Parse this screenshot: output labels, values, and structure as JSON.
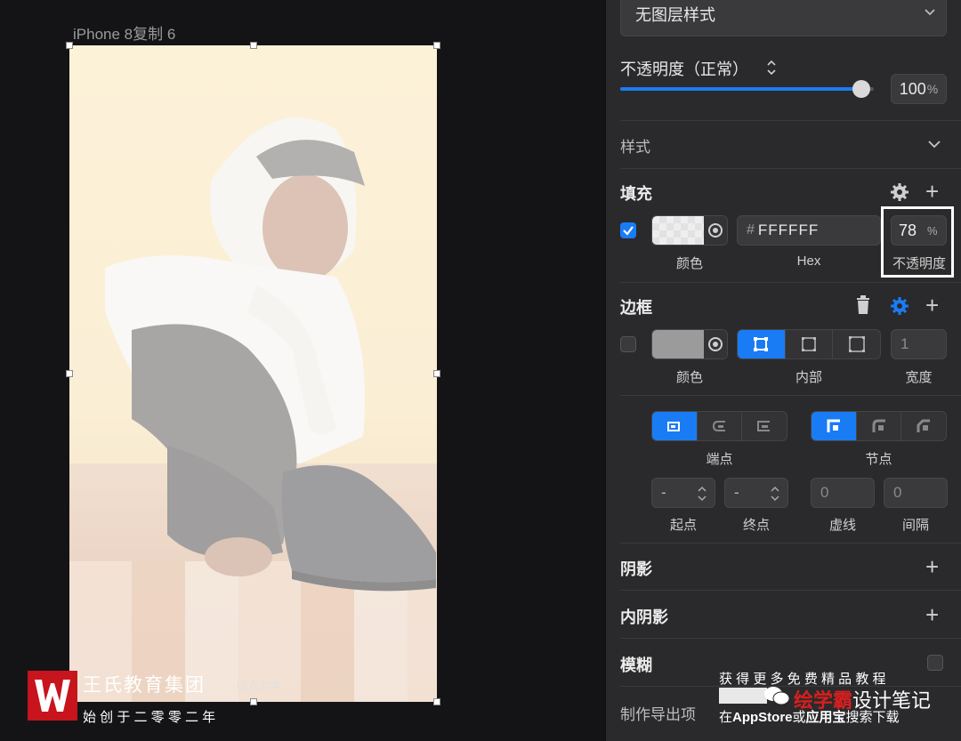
{
  "canvas": {
    "artboard_label": "iPhone 8复制 6"
  },
  "panel": {
    "layer_style_value": "无图层样式",
    "opacity_label": "不透明度（正常）",
    "opacity_value": "100",
    "opacity_unit": "%",
    "opacity_level": 0.95,
    "style_label": "样式",
    "fill": {
      "title": "填充",
      "color_label": "颜色",
      "hex_prefix": "#",
      "hex_value": "FFFFFF",
      "hex_label": "Hex",
      "opacity_value": "78",
      "opacity_unit": "%",
      "opacity_label": "不透明度"
    },
    "border": {
      "title": "边框",
      "color_label": "颜色",
      "position_label": "内部",
      "width_value": "1",
      "width_label": "宽度",
      "endpoint_label": "端点",
      "node_label": "节点",
      "start_value": "-",
      "start_label": "起点",
      "end_value": "-",
      "end_label": "终点",
      "dash_value": "0",
      "dash_label": "虚线",
      "gap_value": "0",
      "gap_label": "间隔"
    },
    "shadow_label": "阴影",
    "inner_shadow_label": "内阴影",
    "blur_label": "模糊",
    "export_label": "制作导出项"
  },
  "watermark_left": {
    "brand": "王氏教育集团",
    "slogan": "以人为本",
    "founded": "始 创 于 二 零 零 二 年"
  },
  "watermark_right": {
    "line1": "获 得 更 多 免 费 精 品 教 程",
    "account_a": "绘学",
    "account_b": "霸",
    "account_c": "设计笔记",
    "line3_a": "在",
    "line3_b": "AppStore",
    "line3_c": "或",
    "line3_d": "应用宝",
    "line3_e": "搜索下载"
  },
  "colors": {
    "accent": "#1a7cf5",
    "panel_bg": "#2a2a2c",
    "canvas_bg": "#141416",
    "highlight_box": "#ffffff"
  }
}
